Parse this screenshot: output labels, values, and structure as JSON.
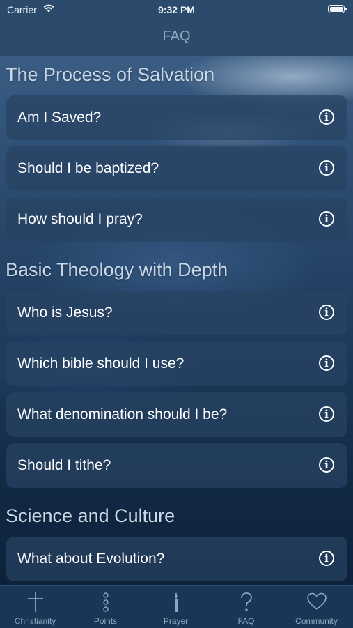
{
  "status": {
    "carrier": "Carrier",
    "time": "9:32 PM"
  },
  "nav": {
    "title": "FAQ"
  },
  "sections": [
    {
      "title": "The Process of Salvation",
      "items": [
        {
          "label": "Am I Saved?"
        },
        {
          "label": "Should I be baptized?"
        },
        {
          "label": "How should I pray?"
        }
      ]
    },
    {
      "title": "Basic Theology with Depth",
      "items": [
        {
          "label": "Who is Jesus?"
        },
        {
          "label": "Which bible should I use?"
        },
        {
          "label": "What denomination should I be?"
        },
        {
          "label": "Should I tithe?"
        }
      ]
    },
    {
      "title": "Science and Culture",
      "items": [
        {
          "label": "What about Evolution?"
        }
      ]
    }
  ],
  "info_glyph": "i",
  "tabs": [
    {
      "label": "Christianity",
      "icon": "cross-icon"
    },
    {
      "label": "Points",
      "icon": "dots-icon"
    },
    {
      "label": "Prayer",
      "icon": "candle-icon"
    },
    {
      "label": "FAQ",
      "icon": "question-icon"
    },
    {
      "label": "Community",
      "icon": "heart-icon"
    }
  ],
  "colors": {
    "nav_bg": "#2c4a6c",
    "tab_bg": "#1a3657",
    "row_bg": "#284262",
    "tab_inactive": "#8fa6bf"
  }
}
